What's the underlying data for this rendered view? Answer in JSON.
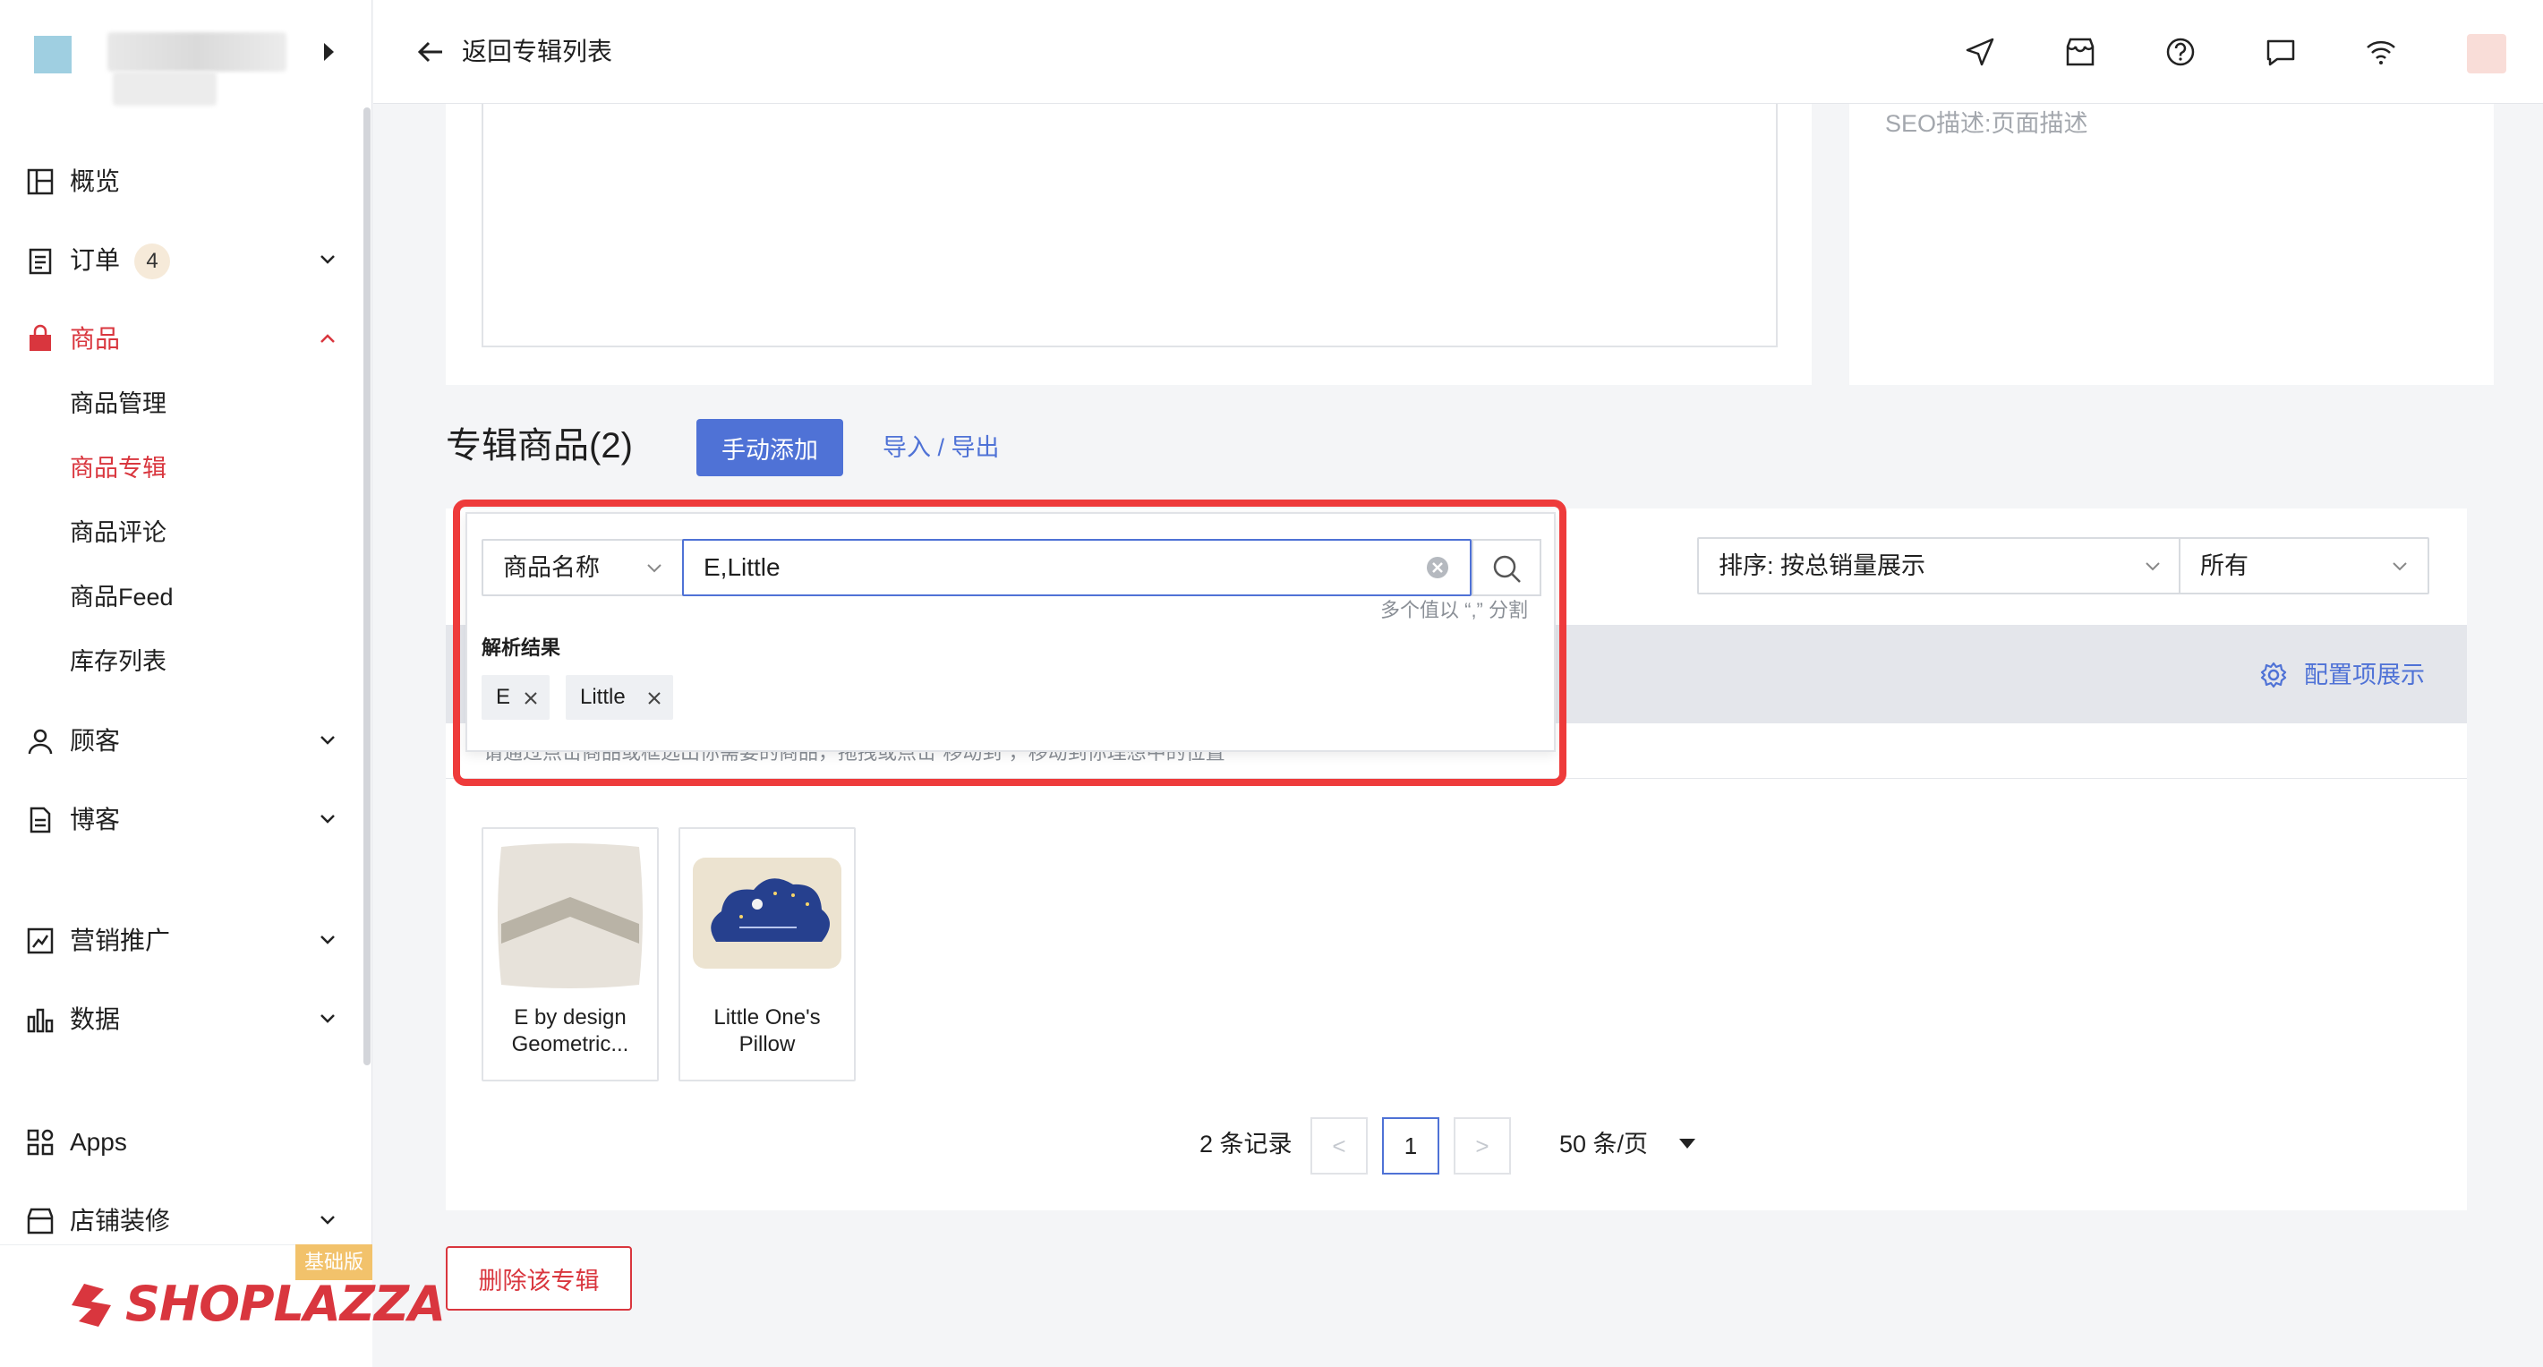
{
  "sidebar": {
    "nav": [
      {
        "label": "概览",
        "icon": "dashboard-icon"
      },
      {
        "label": "订单",
        "badge": "4",
        "icon": "order-icon"
      },
      {
        "label": "商品",
        "icon": "bag-icon"
      },
      {
        "label": "顾客",
        "icon": "user-icon"
      },
      {
        "label": "博客",
        "icon": "blog-icon"
      },
      {
        "label": "营销推广",
        "icon": "marketing-icon"
      },
      {
        "label": "数据",
        "icon": "chart-icon"
      },
      {
        "label": "Apps",
        "icon": "apps-icon"
      },
      {
        "label": "店铺装修",
        "icon": "store-icon"
      }
    ],
    "product_sub": [
      "商品管理",
      "商品专辑",
      "商品评论",
      "商品Feed",
      "库存列表"
    ],
    "plan_badge": "基础版",
    "brand": "SHOPLAZZA"
  },
  "header": {
    "back_label": "返回专辑列表"
  },
  "seo": {
    "placeholder": "SEO描述:页面描述"
  },
  "section": {
    "title": "专辑商品(2)",
    "add_button": "手动添加",
    "import_export": "导入 / 导出"
  },
  "filter": {
    "field_select": "商品名称",
    "search_value": "E,Little",
    "multi_hint": "多个值以 “,” 分割",
    "parse_label": "解析结果",
    "tags": [
      "E",
      "Little"
    ],
    "sort_select": "排序: 按总销量展示",
    "status_select": "所有"
  },
  "table": {
    "config_label": "配置项展示",
    "hint": "请通过点击商品或框选出你需要的商品，拖拽或点击“移动到”，移动到你理想中的位置"
  },
  "products": [
    {
      "name_line1": "E by design",
      "name_line2": "Geometric..."
    },
    {
      "name_line1": "Little One's",
      "name_line2": "Pillow"
    }
  ],
  "pagination": {
    "records": "2 条记录",
    "prev": "<",
    "current": "1",
    "next": ">",
    "per_page": "50 条/页"
  },
  "delete_button": "删除该专辑",
  "colors": {
    "accent": "#4f72d6",
    "danger": "#d9363e",
    "highlight": "#ee3b3b"
  }
}
